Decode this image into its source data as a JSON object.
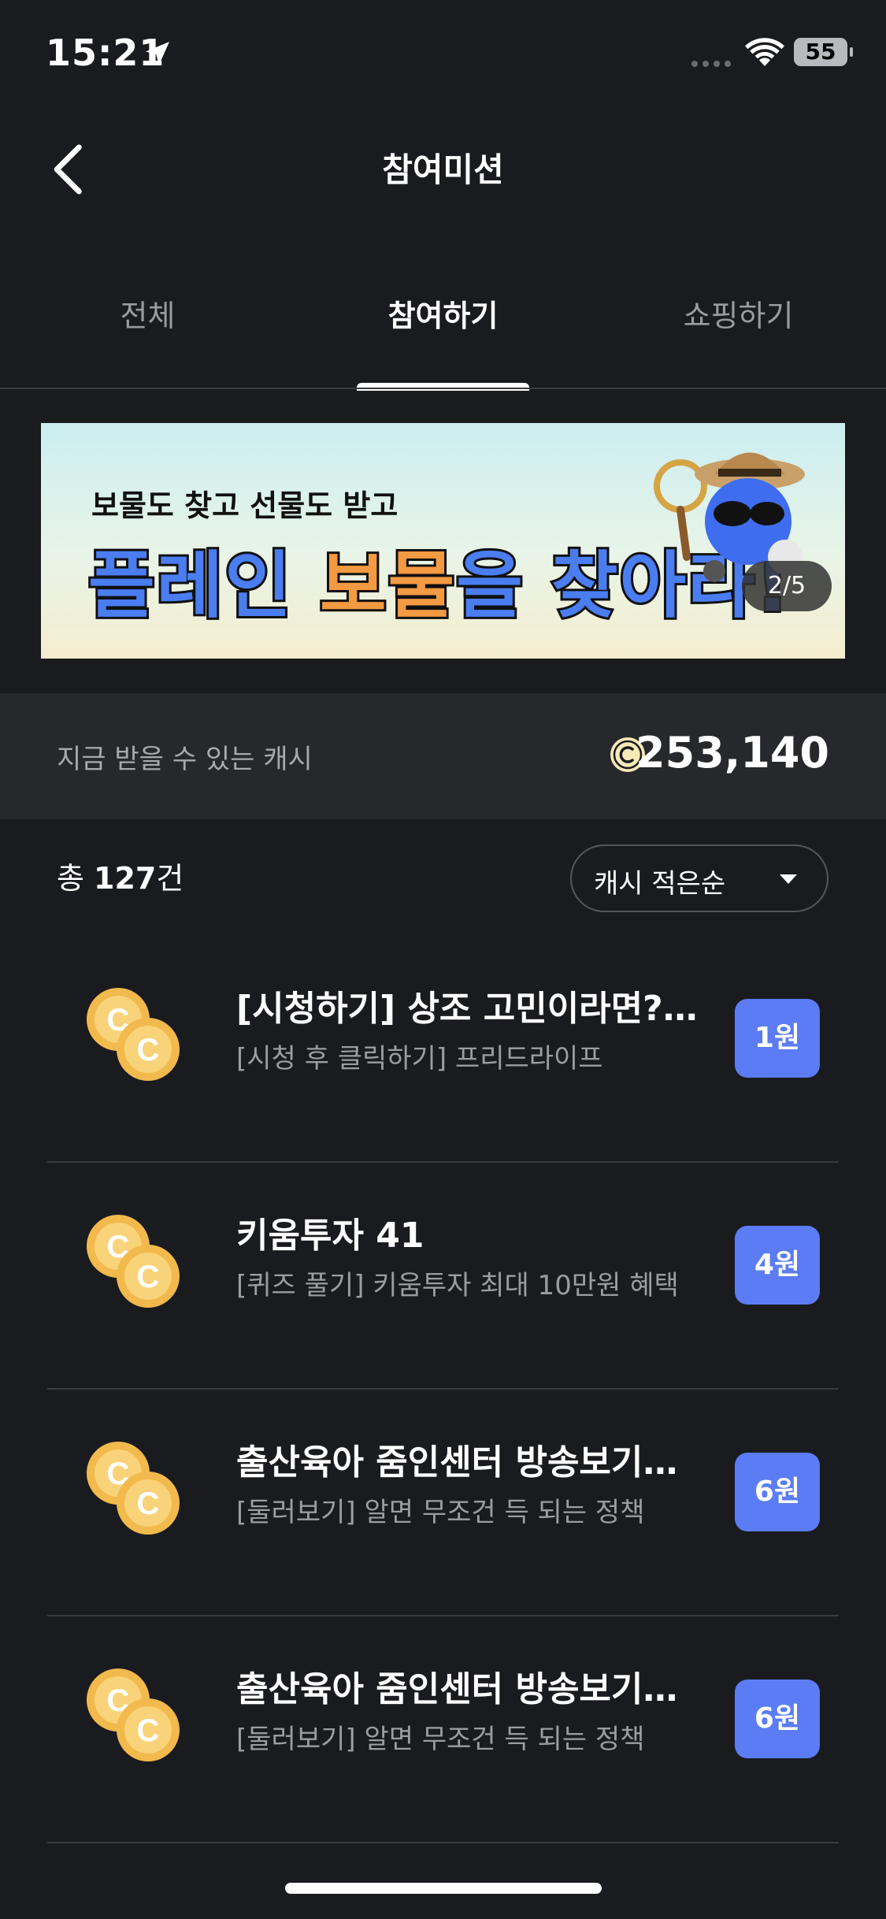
{
  "status_bar": {
    "time": "15:21",
    "battery": "55"
  },
  "header": {
    "title": "참여미션"
  },
  "tabs": [
    {
      "label": "전체",
      "active": false
    },
    {
      "label": "참여하기",
      "active": true
    },
    {
      "label": "쇼핑하기",
      "active": false
    }
  ],
  "banner": {
    "line1": "보물도 찾고 선물도 받고",
    "line2_a": "플레인 ",
    "line2_b": "보물",
    "line2_c": "을 찾아라!",
    "pager": "2/5"
  },
  "cash": {
    "label": "지금 받을 수 있는 캐시",
    "amount": "253,140"
  },
  "list_header": {
    "prefix": "총 ",
    "count": "127",
    "suffix": "건",
    "sort_label": "캐시 적은순"
  },
  "missions": [
    {
      "title": "[시청하기] 상조 고민이라면?…",
      "subtitle": "[시청 후 클릭하기] 프리드라이프",
      "reward": "1원"
    },
    {
      "title": "키움투자 41",
      "subtitle": "[퀴즈 풀기] 키움투자 최대 10만원 혜택",
      "reward": "4원"
    },
    {
      "title": "출산육아 줌인센터 방송보기…",
      "subtitle": "[둘러보기] 알면 무조건 득 되는 정책",
      "reward": "6원"
    },
    {
      "title": "출산육아 줌인센터 방송보기…",
      "subtitle": "[둘러보기] 알면 무조건 득 되는 정책",
      "reward": "6원"
    }
  ],
  "colors": {
    "background": "#1a1b1e",
    "accent": "#5b7cf4",
    "coin": "#f4c25a"
  }
}
